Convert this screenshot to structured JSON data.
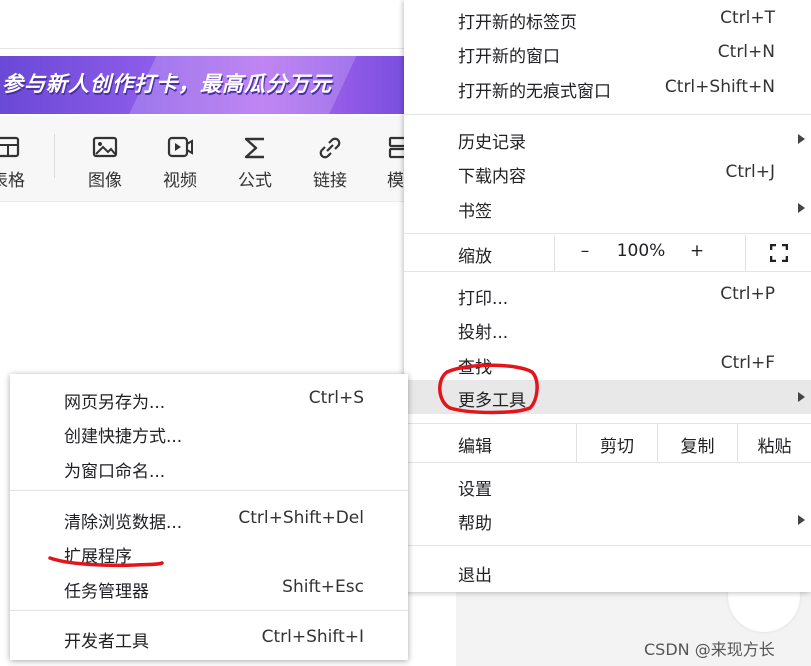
{
  "banner": {
    "text": "参与新人创作打卡，最高瓜分万元"
  },
  "toolbar": {
    "items": [
      {
        "label": "表格",
        "icon": "table-icon"
      },
      {
        "label": "图像",
        "icon": "image-icon"
      },
      {
        "label": "视频",
        "icon": "video-icon"
      },
      {
        "label": "公式",
        "icon": "sigma-icon"
      },
      {
        "label": "链接",
        "icon": "link-icon"
      },
      {
        "label": "模",
        "icon": "template-icon"
      }
    ]
  },
  "main_menu": {
    "new_tab": {
      "label": "打开新的标签页",
      "shortcut": "Ctrl+T"
    },
    "new_window": {
      "label": "打开新的窗口",
      "shortcut": "Ctrl+N"
    },
    "new_incognito": {
      "label": "打开新的无痕式窗口",
      "shortcut": "Ctrl+Shift+N"
    },
    "history": {
      "label": "历史记录"
    },
    "downloads": {
      "label": "下载内容",
      "shortcut": "Ctrl+J"
    },
    "bookmarks": {
      "label": "书签"
    },
    "zoom": {
      "label": "缩放",
      "minus": "–",
      "value": "100%",
      "plus": "+"
    },
    "print": {
      "label": "打印...",
      "shortcut": "Ctrl+P"
    },
    "cast": {
      "label": "投射..."
    },
    "find": {
      "label": "查找",
      "shortcut": "Ctrl+F"
    },
    "more_tools": {
      "label": "更多工具"
    },
    "edit": {
      "label": "编辑",
      "cut": "剪切",
      "copy": "复制",
      "paste": "粘贴"
    },
    "settings": {
      "label": "设置"
    },
    "help": {
      "label": "帮助"
    },
    "exit": {
      "label": "退出"
    }
  },
  "sub_menu": {
    "save_as": {
      "label": "网页另存为...",
      "shortcut": "Ctrl+S"
    },
    "create_shortcut": {
      "label": "创建快捷方式..."
    },
    "name_window": {
      "label": "为窗口命名..."
    },
    "clear_data": {
      "label": "清除浏览数据...",
      "shortcut": "Ctrl+Shift+Del"
    },
    "extensions": {
      "label": "扩展程序"
    },
    "task_manager": {
      "label": "任务管理器",
      "shortcut": "Shift+Esc"
    },
    "dev_tools": {
      "label": "开发者工具",
      "shortcut": "Ctrl+Shift+I"
    }
  },
  "watermark": "CSDN @来现方长",
  "colors": {
    "annotation_red": "#e4141b",
    "menu_highlight": "#e8e8e8",
    "banner_purple": "#7a4fe0"
  }
}
